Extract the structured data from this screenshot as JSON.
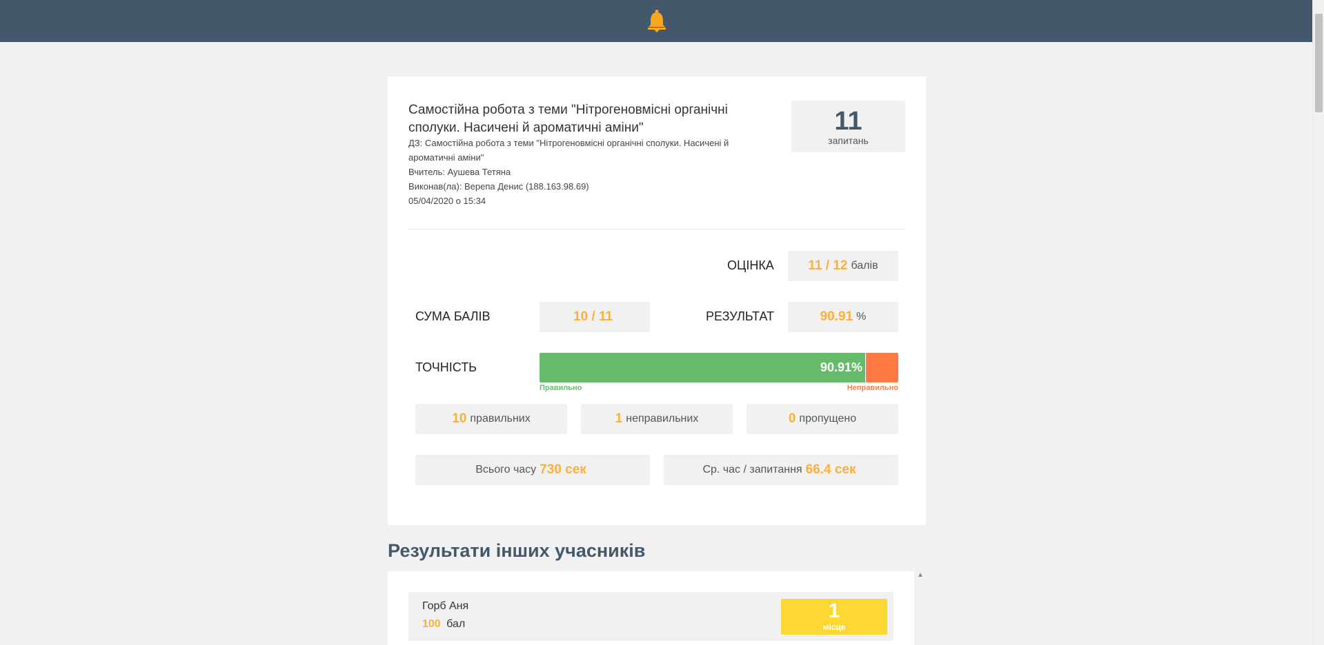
{
  "header": {
    "icon": "bell-icon",
    "icon_color": "#f6a623",
    "bg_color": "#43596b"
  },
  "quiz": {
    "title": "Самостійна робота з теми \"Нітрогеновмісні органічні сполуки. Насичені й ароматичні аміни\"",
    "homework": "ДЗ: Самостійна робота з теми \"Нітрогеновмісні органічні сполуки. Насичені й ароматичні аміни\"",
    "teacher": "Вчитель: Аушева Тетяна",
    "performer": "Виконав(ла): Верепа Денис (188.163.98.69)",
    "datetime": "05/04/2020 о 15:34",
    "questions_count": "11",
    "questions_label": "запитань"
  },
  "stats": {
    "grade_label": "ОЦІНКА",
    "grade_value": "11 / 12",
    "grade_unit": "балів",
    "sum_label": "СУМА БАЛІВ",
    "sum_value": "10 / 11",
    "result_label": "РЕЗУЛЬТАТ",
    "result_value": "90.91",
    "result_unit": "%",
    "accuracy_label": "ТОЧНІСТЬ",
    "accuracy_percent": 90.91,
    "accuracy_text": "90.91%",
    "correct_legend": "Правильно",
    "incorrect_legend": "Неправильно",
    "correct_count": "10",
    "correct_label": "правильних",
    "incorrect_count": "1",
    "incorrect_label": "неправильних",
    "skipped_count": "0",
    "skipped_label": "пропущено",
    "total_time_label": "Всього часу",
    "total_time_value": "730 сек",
    "avg_time_label": "Ср. час / запитання",
    "avg_time_value": "66.4 сек",
    "colors": {
      "accent": "#fbb03b",
      "correct": "#66bb6a",
      "incorrect": "#ff7a45"
    }
  },
  "others": {
    "title": "Результати інших учасників",
    "rows": [
      {
        "name": "Горб Аня",
        "points": "100",
        "points_label": "бал",
        "place": "1",
        "place_label": "місце"
      }
    ]
  }
}
